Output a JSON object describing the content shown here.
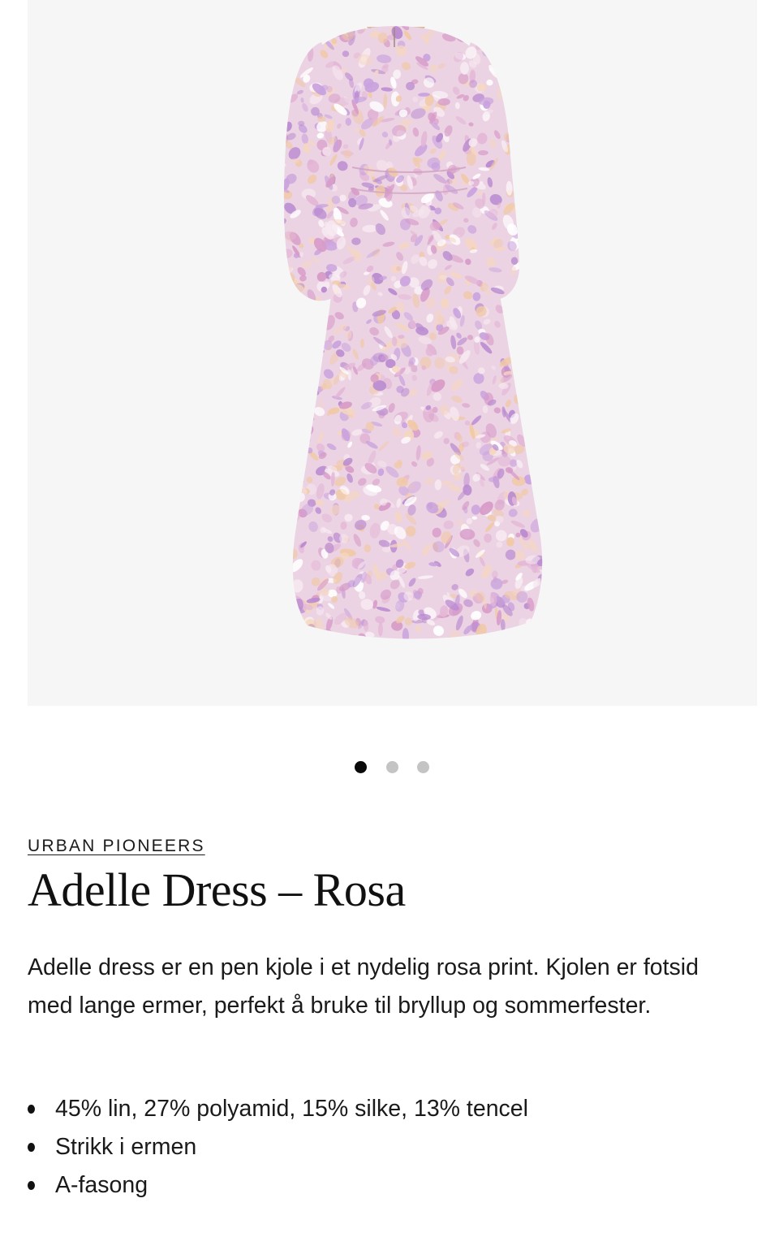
{
  "gallery": {
    "image_alt": "Adelle Dress – Rosa",
    "slide_count": 3,
    "active_slide": 1,
    "colors": {
      "background": "#f6f6f6",
      "dress_base": "#e9cde0",
      "print_pink": "#d79bc8",
      "print_purple": "#b98ad0",
      "print_peach": "#f0c9a6",
      "lining": "#d9b99a"
    }
  },
  "product": {
    "brand": "URBAN PIONEERS",
    "title": "Adelle Dress – Rosa",
    "description": "Adelle dress er en pen kjole i et nydelig rosa print. Kjolen er fotsid med lange ermer, perfekt å bruke til bryllup og sommerfester.",
    "features": [
      "45% lin, 27% polyamid, 15% silke, 13% tencel",
      "Strikk i ermen",
      "A-fasong"
    ]
  }
}
